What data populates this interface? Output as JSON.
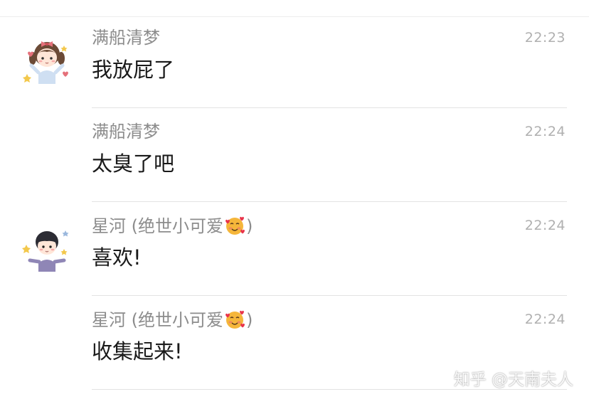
{
  "messages": [
    {
      "avatar": "cartoon-girl-avatar",
      "show_avatar": true,
      "sender": "满船清梦",
      "sender_emoji": "",
      "sender_suffix": "",
      "time": "22:23",
      "content": "我放屁了"
    },
    {
      "avatar": "",
      "show_avatar": false,
      "sender": "满船清梦",
      "sender_emoji": "",
      "sender_suffix": "",
      "time": "22:24",
      "content": "太臭了吧"
    },
    {
      "avatar": "cartoon-boy-avatar",
      "show_avatar": true,
      "sender": "星河 (绝世小可爱",
      "sender_emoji": "smiling-face-with-hearts-emoji",
      "sender_suffix": ")",
      "time": "22:24",
      "content": "喜欢!"
    },
    {
      "avatar": "",
      "show_avatar": false,
      "sender": "星河 (绝世小可爱",
      "sender_emoji": "smiling-face-with-hearts-emoji",
      "sender_suffix": ")",
      "time": "22:24",
      "content": "收集起来!"
    }
  ],
  "watermark": "知乎 @天南夫人",
  "colors": {
    "sender": "#8c8c8c",
    "time": "#b0b0b0",
    "content": "#1a1a1a",
    "divider": "#e3e3e3",
    "emoji": "#f5b63a"
  }
}
